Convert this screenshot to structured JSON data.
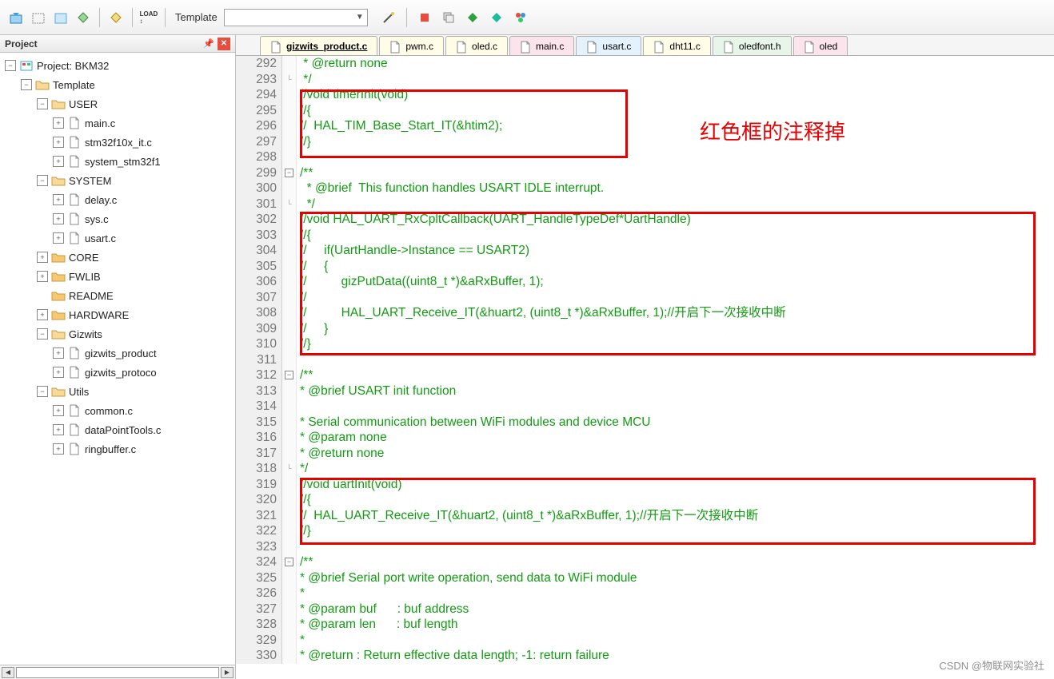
{
  "toolbar": {
    "template_label": "Template"
  },
  "panel": {
    "title": "Project"
  },
  "tree": {
    "root": "Project: BKM32",
    "template": "Template",
    "user": "USER",
    "user_files": [
      "main.c",
      "stm32f10x_it.c",
      "system_stm32f1"
    ],
    "system": "SYSTEM",
    "system_files": [
      "delay.c",
      "sys.c",
      "usart.c"
    ],
    "core": "CORE",
    "fwlib": "FWLIB",
    "readme": "README",
    "hardware": "HARDWARE",
    "gizwits": "Gizwits",
    "gizwits_files": [
      "gizwits_product",
      "gizwits_protoco"
    ],
    "utils": "Utils",
    "utils_files": [
      "common.c",
      "dataPointTools.c",
      "ringbuffer.c"
    ]
  },
  "tabs": [
    {
      "label": "gizwits_product.c",
      "cls": "active c-yellow"
    },
    {
      "label": "pwm.c",
      "cls": "c-yellow"
    },
    {
      "label": "oled.c",
      "cls": "c-yellow"
    },
    {
      "label": "main.c",
      "cls": "c-pink"
    },
    {
      "label": "usart.c",
      "cls": "c-blue"
    },
    {
      "label": "dht11.c",
      "cls": "c-yellow"
    },
    {
      "label": "oledfont.h",
      "cls": "c-green"
    },
    {
      "label": "oled",
      "cls": "c-pink"
    }
  ],
  "annotation": "红色框的注释掉",
  "watermark": "CSDN @物联网实验社",
  "code": {
    "start": 292,
    "lines": [
      {
        "t": " * @return none",
        "c": "cmt"
      },
      {
        "t": " */",
        "c": "cmt",
        "fold": "close"
      },
      {
        "t": "//void timerInit(void)",
        "c": "cmt"
      },
      {
        "t": "//{",
        "c": "cmt"
      },
      {
        "t": "//  HAL_TIM_Base_Start_IT(&htim2);",
        "c": "cmt"
      },
      {
        "t": "//}",
        "c": "cmt"
      },
      {
        "t": "",
        "c": ""
      },
      {
        "t": "/**",
        "c": "cmt",
        "fold": "open"
      },
      {
        "t": "  * @brief  This function handles USART IDLE interrupt.",
        "c": "cmt"
      },
      {
        "t": "  */",
        "c": "cmt",
        "fold": "close"
      },
      {
        "t": "//void HAL_UART_RxCpltCallback(UART_HandleTypeDef*UartHandle)",
        "c": "cmt"
      },
      {
        "t": "//{",
        "c": "cmt"
      },
      {
        "t": "//     if(UartHandle->Instance == USART2)",
        "c": "cmt"
      },
      {
        "t": "//     {",
        "c": "cmt"
      },
      {
        "t": "//          gizPutData((uint8_t *)&aRxBuffer, 1);",
        "c": "cmt"
      },
      {
        "t": "//",
        "c": "cmt"
      },
      {
        "t": "//          HAL_UART_Receive_IT(&huart2, (uint8_t *)&aRxBuffer, 1);//开启下一次接收中断",
        "c": "cmt"
      },
      {
        "t": "//     }",
        "c": "cmt"
      },
      {
        "t": "//}",
        "c": "cmt"
      },
      {
        "t": "",
        "c": ""
      },
      {
        "t": "/**",
        "c": "cmt",
        "fold": "open"
      },
      {
        "t": "* @brief USART init function",
        "c": "cmt"
      },
      {
        "t": "",
        "c": ""
      },
      {
        "t": "* Serial communication between WiFi modules and device MCU",
        "c": "cmt"
      },
      {
        "t": "* @param none",
        "c": "cmt"
      },
      {
        "t": "* @return none",
        "c": "cmt"
      },
      {
        "t": "*/",
        "c": "cmt",
        "fold": "close"
      },
      {
        "t": "//void uartInit(void)",
        "c": "cmt"
      },
      {
        "t": "//{",
        "c": "cmt"
      },
      {
        "t": "//  HAL_UART_Receive_IT(&huart2, (uint8_t *)&aRxBuffer, 1);//开启下一次接收中断",
        "c": "cmt"
      },
      {
        "t": "//}",
        "c": "cmt"
      },
      {
        "t": "",
        "c": ""
      },
      {
        "t": "/**",
        "c": "cmt",
        "fold": "open"
      },
      {
        "t": "* @brief Serial port write operation, send data to WiFi module",
        "c": "cmt"
      },
      {
        "t": "*",
        "c": "cmt"
      },
      {
        "t": "* @param buf      : buf address",
        "c": "cmt"
      },
      {
        "t": "* @param len      : buf length",
        "c": "cmt"
      },
      {
        "t": "*",
        "c": "cmt"
      },
      {
        "t": "* @return : Return effective data length; -1: return failure",
        "c": "cmt"
      }
    ]
  }
}
